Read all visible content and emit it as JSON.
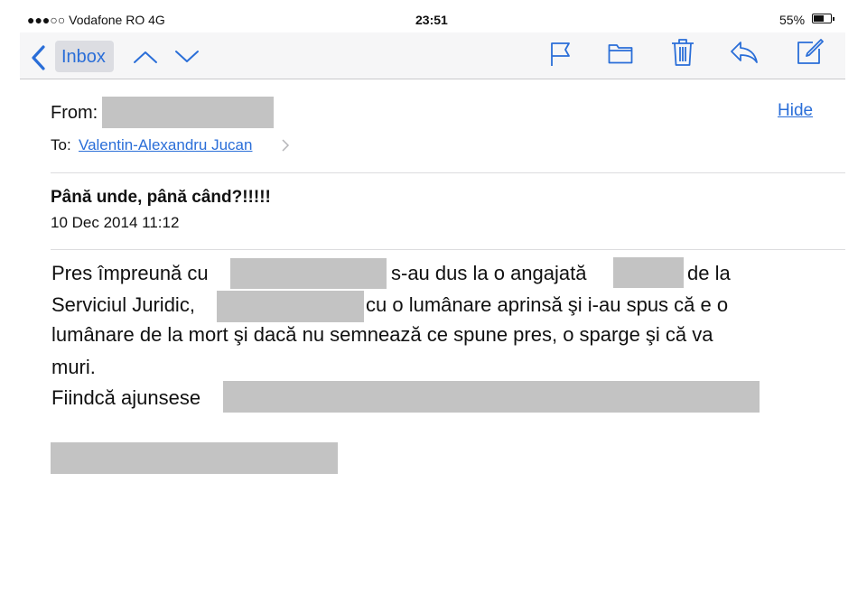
{
  "status_bar": {
    "carrier": "●●●○○ Vodafone RO  4G",
    "time": "23:51",
    "battery_percent": "55%"
  },
  "navbar": {
    "back_label": "Inbox",
    "icons": [
      "chevron-up-icon",
      "chevron-down-icon",
      "flag-icon",
      "folder-icon",
      "trash-icon",
      "reply-icon",
      "compose-icon"
    ],
    "accent_color": "#2a6ed8"
  },
  "header": {
    "from_label": "From:",
    "hide_label": "Hide",
    "to_label": "To:",
    "to_name": "Valentin-Alexandru Jucan"
  },
  "message": {
    "subject": "Până unde, până când?!!!!!",
    "date": "10 Dec 2014 11:12",
    "body": {
      "l1a": "Pres împreună cu",
      "l1b": "s-au dus la o angajată",
      "l1c": "de la",
      "l2a": "Serviciul Juridic,",
      "l2b": "cu o lumânare aprinsă şi i-au spus că e o",
      "l3": "lumânare de la mort şi dacă nu semnează ce spune pres, o sparge şi că va",
      "l4": "muri.",
      "l5": "Fiindcă ajunsese"
    }
  }
}
